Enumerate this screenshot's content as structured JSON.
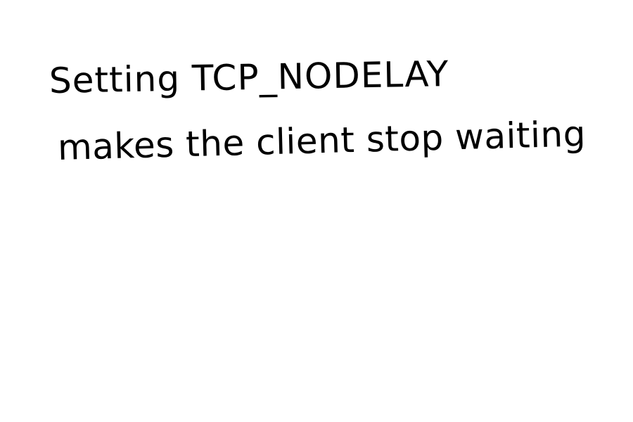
{
  "note": {
    "lines": [
      "Setting TCP_NODELAY",
      "makes the client stop waiting"
    ],
    "ink_color": "#000000",
    "background_color": "#ffffff"
  }
}
